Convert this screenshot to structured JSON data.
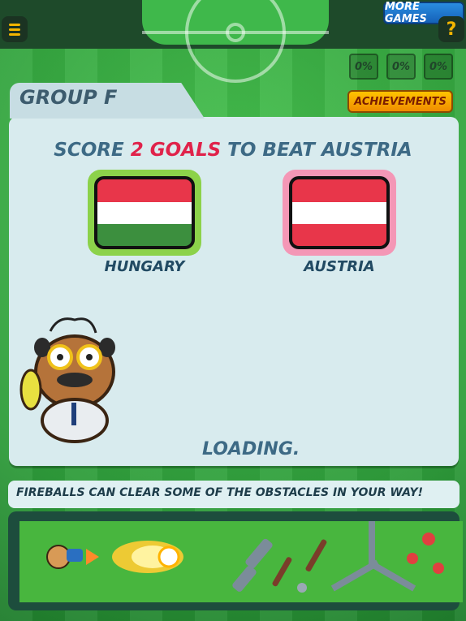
{
  "header": {
    "more_games_label": "MORE GAMES",
    "menu_icon": "hamburger-icon",
    "help_label": "?",
    "stats": [
      "0%",
      "0%",
      "0%"
    ]
  },
  "group": {
    "label": "GROUP F",
    "achievements_label": "ACHIEVEMENTS"
  },
  "match": {
    "headline_pre": "SCORE ",
    "headline_highlight": "2 GOALS",
    "headline_post": " TO BEAT AUSTRIA",
    "home": {
      "name": "HUNGARY",
      "flag_colors": [
        "#e8364a",
        "#ffffff",
        "#3c8f3e"
      ]
    },
    "away": {
      "name": "AUSTRIA",
      "flag_colors": [
        "#e8364a",
        "#ffffff",
        "#e8364a"
      ]
    },
    "status": "LOADING."
  },
  "tip": {
    "text": "FIREBALLS CAN CLEAR SOME OF THE OBSTACLES IN YOUR WAY!"
  },
  "colors": {
    "accent_red": "#e0224a",
    "headline_blue": "#3d6a85",
    "achievements_orange": "#f3a000",
    "more_games_blue": "#1e78d0"
  }
}
